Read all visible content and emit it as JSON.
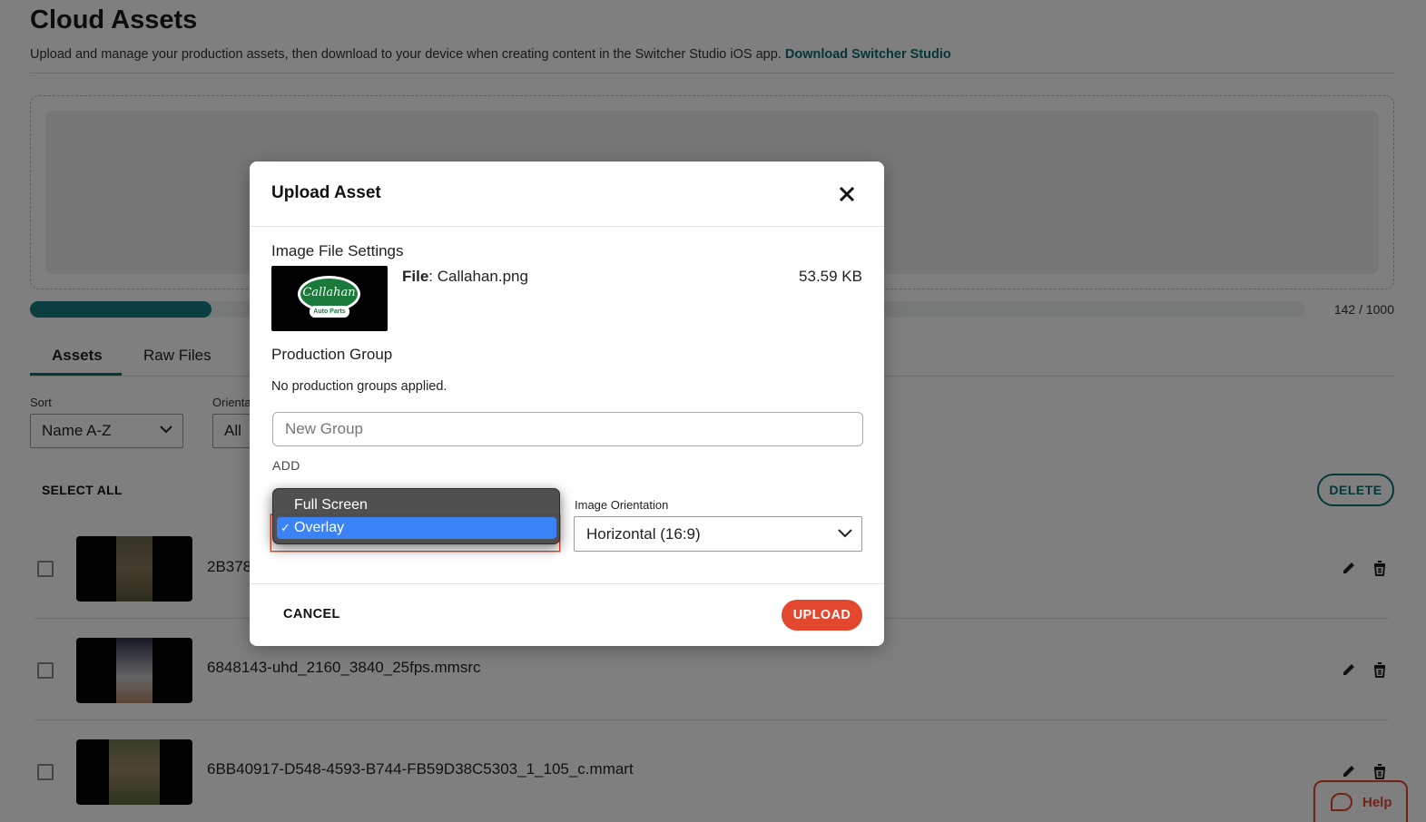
{
  "page": {
    "title": "Cloud Assets",
    "subtitle": "Upload and manage your production assets, then download to your device when creating content in the Switcher Studio iOS app.",
    "subtitle_link": "Download Switcher Studio",
    "usage_count": "142 / 1000",
    "usage_fraction": 0.142
  },
  "tabs": [
    {
      "label": "Assets",
      "active": true
    },
    {
      "label": "Raw Files",
      "active": false
    }
  ],
  "filters": {
    "sort_label": "Sort",
    "sort_value": "Name A-Z",
    "orientation_label": "Orienta",
    "orientation_value": "All"
  },
  "list": {
    "select_all_label": "SELECT ALL",
    "delete_label": "DELETE",
    "rows": [
      {
        "name": "2B378"
      },
      {
        "name": "6848143-uhd_2160_3840_25fps.mmsrc"
      },
      {
        "name": "6BB40917-D548-4593-B744-FB59D38C5303_1_105_c.mmart"
      }
    ]
  },
  "help": {
    "label": "Help"
  },
  "modal": {
    "title": "Upload Asset",
    "image_settings_title": "Image File Settings",
    "file_label": "File",
    "file_name": ": Callahan.png",
    "file_size": "53.59 KB",
    "logo_text": "Callahan",
    "logo_sub": "Auto Parts",
    "production_group_title": "Production Group",
    "no_groups_text": "No production groups applied.",
    "group_placeholder": "New Group",
    "add_label": "ADD",
    "orientation_label": "Image Orientation",
    "orientation_value": "Horizontal (16:9)",
    "cancel_label": "CANCEL",
    "upload_label": "UPLOAD"
  },
  "type_dropdown": {
    "options": [
      {
        "label": "Full Screen",
        "selected": false
      },
      {
        "label": "Overlay",
        "selected": true
      }
    ],
    "check_glyph": "✓"
  },
  "colors": {
    "accent_teal": "#0b6e6e",
    "accent_orange": "#e3472d",
    "select_blue": "#3a82f6"
  }
}
